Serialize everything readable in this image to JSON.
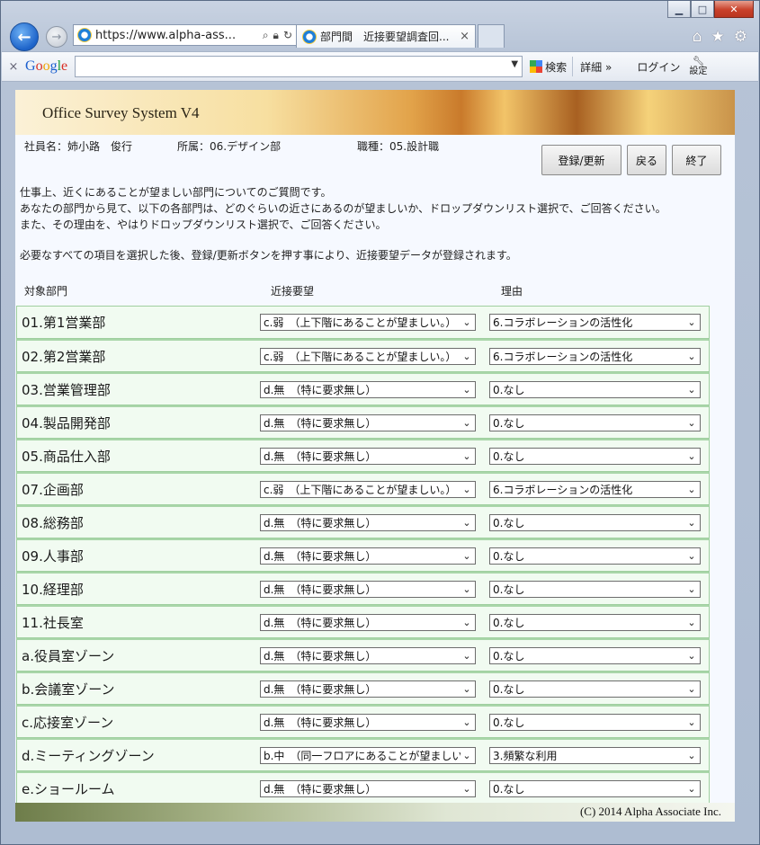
{
  "browser": {
    "address": "https://www.alpha-ass...",
    "tab_title": "部門間　近接要望調査回...",
    "tab_close": "×"
  },
  "toolbar": {
    "close": "×",
    "search_label": "検索",
    "more_label": "詳細 »",
    "login_label": "ログイン",
    "settings_label": "設定"
  },
  "app": {
    "title": "Office Survey System V4",
    "user_name": "社員名：姉小路　俊行",
    "department": "所属：06.デザイン部",
    "job": "職種：05.設計職",
    "buttons": {
      "register": "登録/更新",
      "back": "戻る",
      "exit": "終了"
    },
    "intro_lines": [
      "仕事上、近くにあることが望ましい部門についてのご質問です。",
      "あなたの部門から見て、以下の各部門は、どのぐらいの近さにあるのが望ましいか、ドロップダウンリスト選択で、ご回答ください。",
      "また、その理由を、やはりドロップダウンリスト選択で、ご回答ください。"
    ],
    "intro2": "必要なすべての項目を選択した後、登録/更新ボタンを押す事により、近接要望データが登録されます。",
    "columns": {
      "target": "対象部門",
      "proximity": "近接要望",
      "reason": "理由"
    },
    "rows": [
      {
        "dept": "01.第1営業部",
        "proximity": "c.弱　（上下階にあることが望ましい。）",
        "reason": "6.コラボレーションの活性化"
      },
      {
        "dept": "02.第2営業部",
        "proximity": "c.弱　（上下階にあることが望ましい。）",
        "reason": "6.コラボレーションの活性化"
      },
      {
        "dept": "03.営業管理部",
        "proximity": "d.無　（特に要求無し）",
        "reason": "0.なし"
      },
      {
        "dept": "04.製品開発部",
        "proximity": "d.無　（特に要求無し）",
        "reason": "0.なし"
      },
      {
        "dept": "05.商品仕入部",
        "proximity": "d.無　（特に要求無し）",
        "reason": "0.なし"
      },
      {
        "dept": "07.企画部",
        "proximity": "c.弱　（上下階にあることが望ましい。）",
        "reason": "6.コラボレーションの活性化"
      },
      {
        "dept": "08.総務部",
        "proximity": "d.無　（特に要求無し）",
        "reason": "0.なし"
      },
      {
        "dept": "09.人事部",
        "proximity": "d.無　（特に要求無し）",
        "reason": "0.なし"
      },
      {
        "dept": "10.経理部",
        "proximity": "d.無　（特に要求無し）",
        "reason": "0.なし"
      },
      {
        "dept": "11.社長室",
        "proximity": "d.無　（特に要求無し）",
        "reason": "0.なし"
      },
      {
        "dept": "a.役員室ゾーン",
        "proximity": "d.無　（特に要求無し）",
        "reason": "0.なし"
      },
      {
        "dept": "b.会議室ゾーン",
        "proximity": "d.無　（特に要求無し）",
        "reason": "0.なし"
      },
      {
        "dept": "c.応接室ゾーン",
        "proximity": "d.無　（特に要求無し）",
        "reason": "0.なし"
      },
      {
        "dept": "d.ミーティングゾーン",
        "proximity": "b.中　（同一フロアにあることが望ましい。）",
        "reason": "3.頻繁な利用"
      },
      {
        "dept": "e.ショールーム",
        "proximity": "d.無　（特に要求無し）",
        "reason": "0.なし"
      }
    ],
    "footer": "(C) 2014 Alpha Associate Inc."
  }
}
